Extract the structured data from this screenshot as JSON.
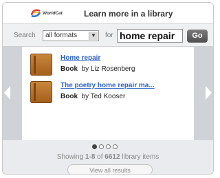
{
  "header": {
    "logo_text": "WorldCat",
    "title": "Learn more in a library"
  },
  "search": {
    "label": "Search",
    "format_selected": "all formats",
    "for_label": "for",
    "query": "home repair",
    "go_label": "Go"
  },
  "results": [
    {
      "title": "Home repair",
      "type": "Book",
      "by": "by Liz Rosenberg"
    },
    {
      "title": "The poetry home repair ma...",
      "type": "Book",
      "by": "by Ted Kooser"
    }
  ],
  "pagination": {
    "pages": 4,
    "active_index": 0
  },
  "summary": {
    "prefix": "Showing ",
    "range": "1-8",
    "of": " of ",
    "total": "6612",
    "suffix": " library items"
  },
  "view_all_label": "View all results"
}
